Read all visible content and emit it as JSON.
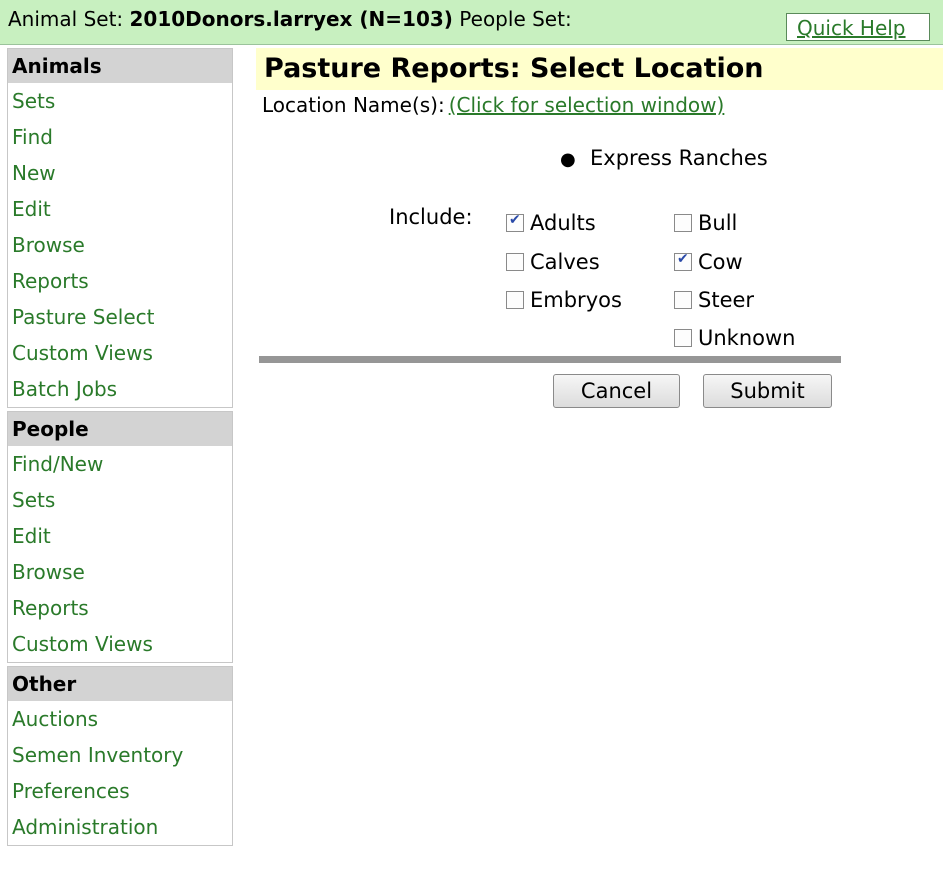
{
  "topbar": {
    "animal_set_label": "Animal Set:",
    "animal_set_value": "2010Donors.larryex (N=103)",
    "people_set_label": "People Set:",
    "quick_help": "Quick Help"
  },
  "sidebar": {
    "animals": {
      "header": "Animals",
      "items": [
        "Sets",
        "Find",
        "New",
        "Edit",
        "Browse",
        "Reports",
        "Pasture Select",
        "Custom Views",
        "Batch Jobs"
      ]
    },
    "people": {
      "header": "People",
      "items": [
        "Find/New",
        "Sets",
        "Edit",
        "Browse",
        "Reports",
        "Custom Views"
      ]
    },
    "other": {
      "header": "Other",
      "items": [
        "Auctions",
        "Semen Inventory",
        "Preferences",
        "Administration"
      ]
    }
  },
  "main": {
    "title": "Pasture Reports: Select Location",
    "location_label": "Location Name(s):",
    "location_link": "(Click for selection window)",
    "locations": [
      "Express Ranches"
    ],
    "include_label": "Include:",
    "age_options": [
      {
        "label": "Adults",
        "checked": true
      },
      {
        "label": "Calves",
        "checked": false
      },
      {
        "label": "Embryos",
        "checked": false
      }
    ],
    "sex_options": [
      {
        "label": "Bull",
        "checked": false
      },
      {
        "label": "Cow",
        "checked": true
      },
      {
        "label": "Steer",
        "checked": false
      },
      {
        "label": "Unknown",
        "checked": false
      }
    ],
    "cancel_label": "Cancel",
    "submit_label": "Submit"
  },
  "colors": {
    "topbar_bg": "#c8f0c0",
    "title_bg": "#ffffcc",
    "link": "#2a7a2a",
    "nav_header_bg": "#d3d3d3"
  }
}
